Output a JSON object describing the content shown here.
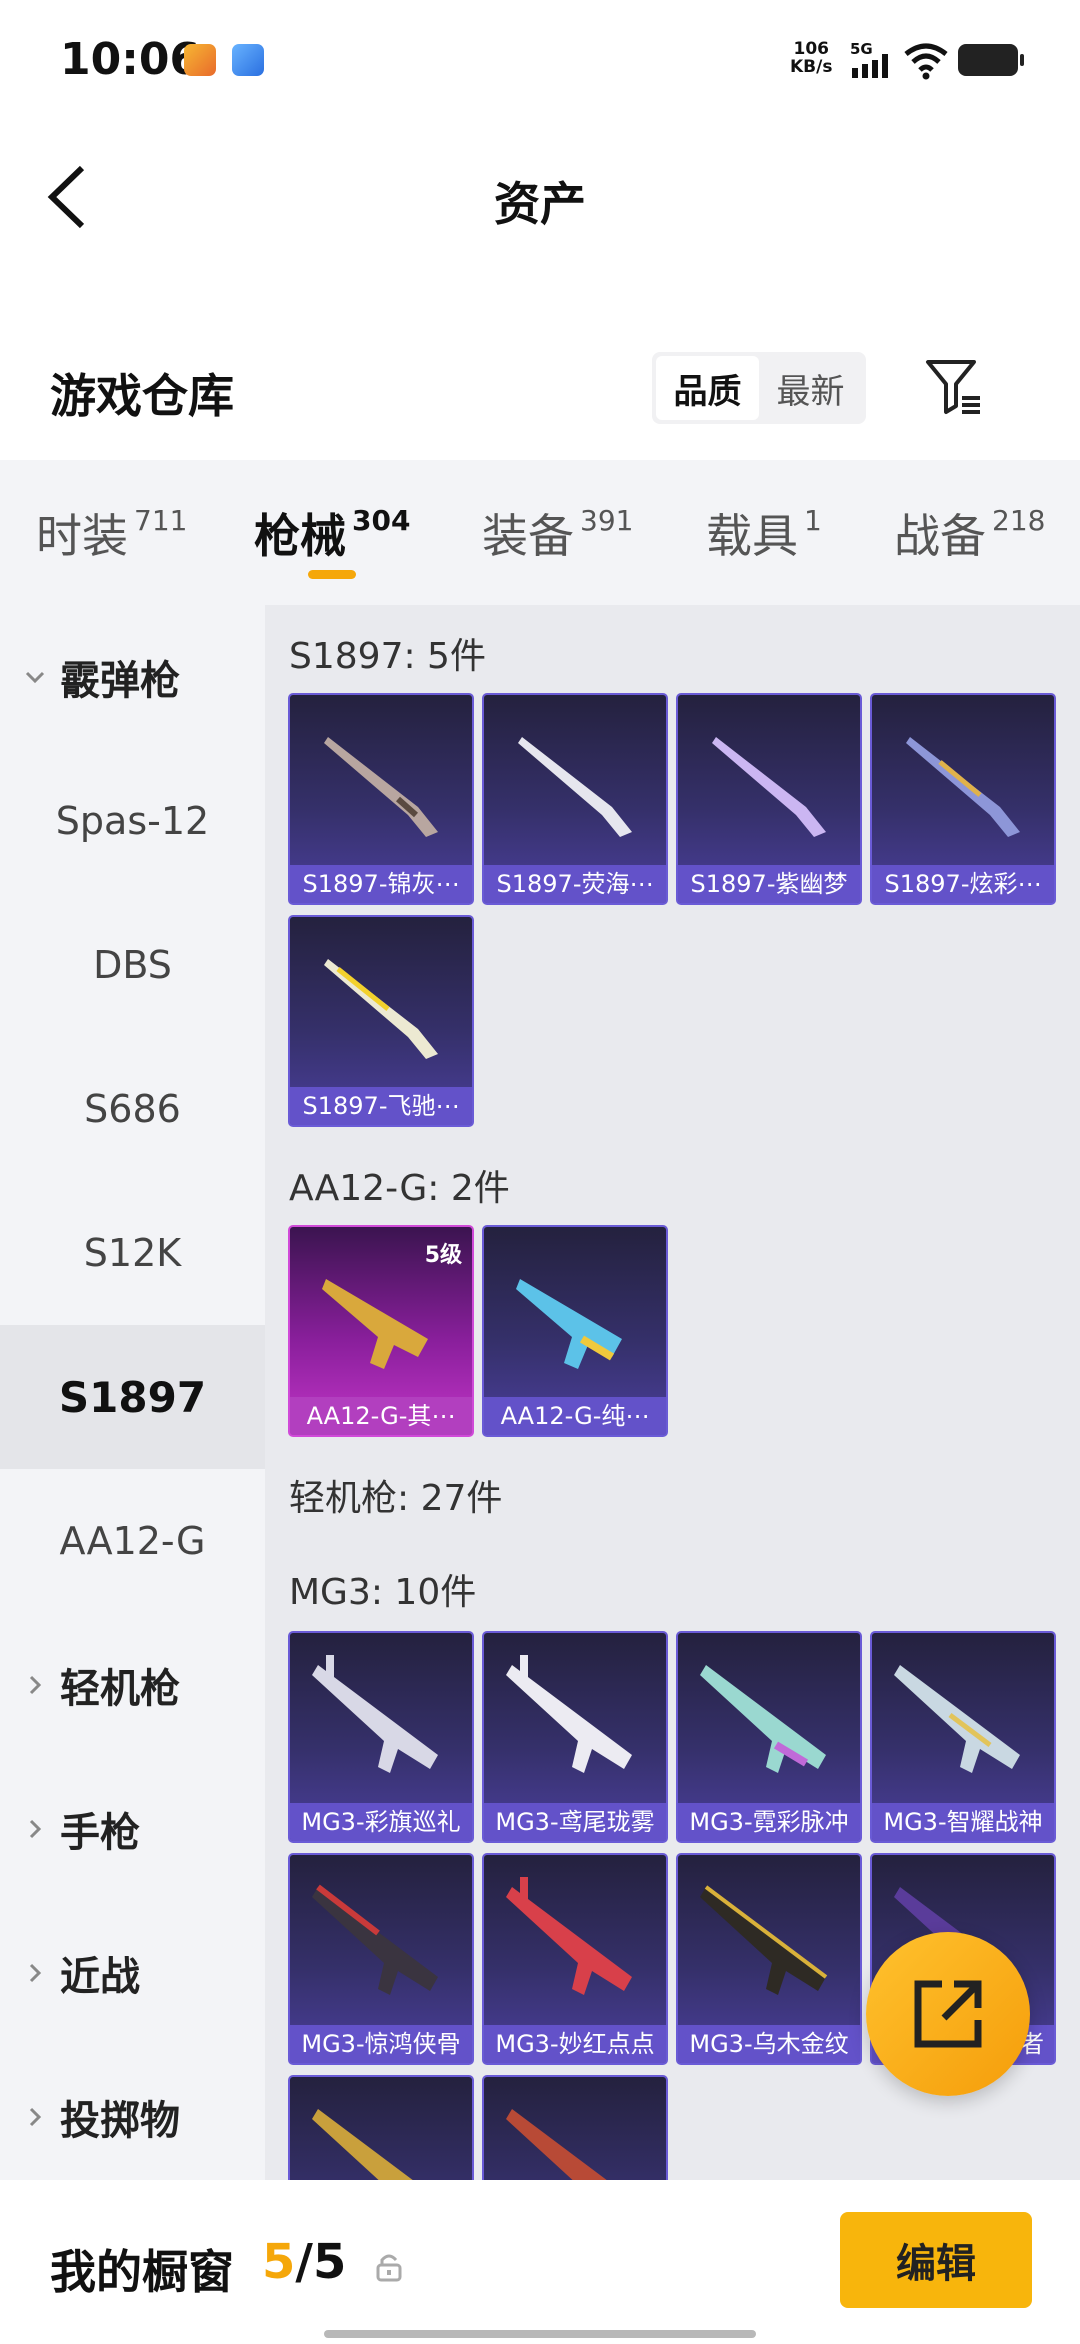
{
  "status": {
    "time": "10:06",
    "net_speed": "106",
    "net_unit": "KB/s",
    "network": "5G"
  },
  "header": {
    "title": "资产"
  },
  "warehouse": {
    "title": "游戏仓库",
    "sort_quality": "品质",
    "sort_latest": "最新"
  },
  "tabs": [
    {
      "label": "时装",
      "count": "711"
    },
    {
      "label": "枪械",
      "count": "304"
    },
    {
      "label": "装备",
      "count": "391"
    },
    {
      "label": "载具",
      "count": "1"
    },
    {
      "label": "战备",
      "count": "218"
    }
  ],
  "sidebar": {
    "items": [
      "霰弹枪",
      "Spas-12",
      "DBS",
      "S686",
      "S12K",
      "S1897",
      "AA12-G",
      "轻机枪",
      "手枪",
      "近战",
      "投掷物"
    ]
  },
  "sections": {
    "s1897_title": "S1897: 5件",
    "s1897": [
      "S1897-锦灰⋯",
      "S1897-荧海⋯",
      "S1897-紫幽梦",
      "S1897-炫彩⋯",
      "S1897-飞驰⋯"
    ],
    "aa12_title": "AA12-G: 2件",
    "aa12": [
      "AA12-G-其⋯",
      "AA12-G-纯⋯"
    ],
    "aa12_level": "5级",
    "lmg_title": "轻机枪: 27件",
    "mg3_title": "MG3: 10件",
    "mg3": [
      "MG3-彩旗巡礼",
      "MG3-鸢尾珑雾",
      "MG3-霓彩脉冲",
      "MG3-智耀战神",
      "MG3-惊鸿侠骨",
      "MG3-妙红点点",
      "MG3-乌木金纹",
      "者"
    ]
  },
  "bottom": {
    "showcase_label": "我的橱窗",
    "used": "5",
    "separator": "/",
    "total": "5",
    "edit_label": "编辑"
  },
  "colors": {
    "accent": "#f5a70a",
    "card_purple": "#6352c9",
    "card_pink": "#b23fbf"
  }
}
